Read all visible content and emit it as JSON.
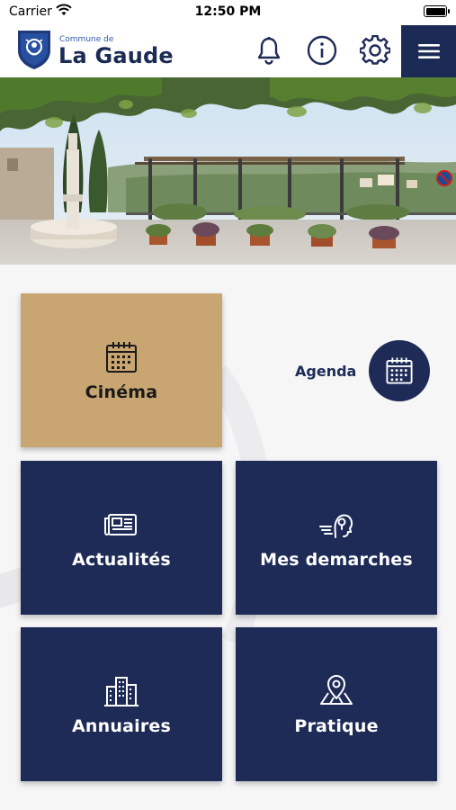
{
  "status_bar": {
    "carrier": "Carrier",
    "time": "12:50 PM"
  },
  "header": {
    "logo_small": "Commune de",
    "logo_big": "La Gaude",
    "icons": [
      "bell-icon",
      "info-icon",
      "gear-icon",
      "hamburger-menu-icon"
    ]
  },
  "hero": {
    "alt": "Village square with fountain and pergola overlooking hills"
  },
  "tiles": [
    {
      "label": "Cinéma",
      "icon": "calendar-icon",
      "color": "#c8a571"
    },
    {
      "label": "Actualités",
      "icon": "newspaper-icon",
      "color": "#1e2b57"
    },
    {
      "label": "Mes demarches",
      "icon": "person-headset-icon",
      "color": "#1e2b57"
    },
    {
      "label": "Annuaires",
      "icon": "buildings-icon",
      "color": "#1e2b57"
    },
    {
      "label": "Pratique",
      "icon": "map-pin-icon",
      "color": "#1e2b57"
    }
  ],
  "agenda": {
    "label": "Agenda",
    "icon": "calendar-icon"
  },
  "colors": {
    "navy": "#1e2b57",
    "gold": "#c8a571",
    "background": "#f6f6f7"
  }
}
